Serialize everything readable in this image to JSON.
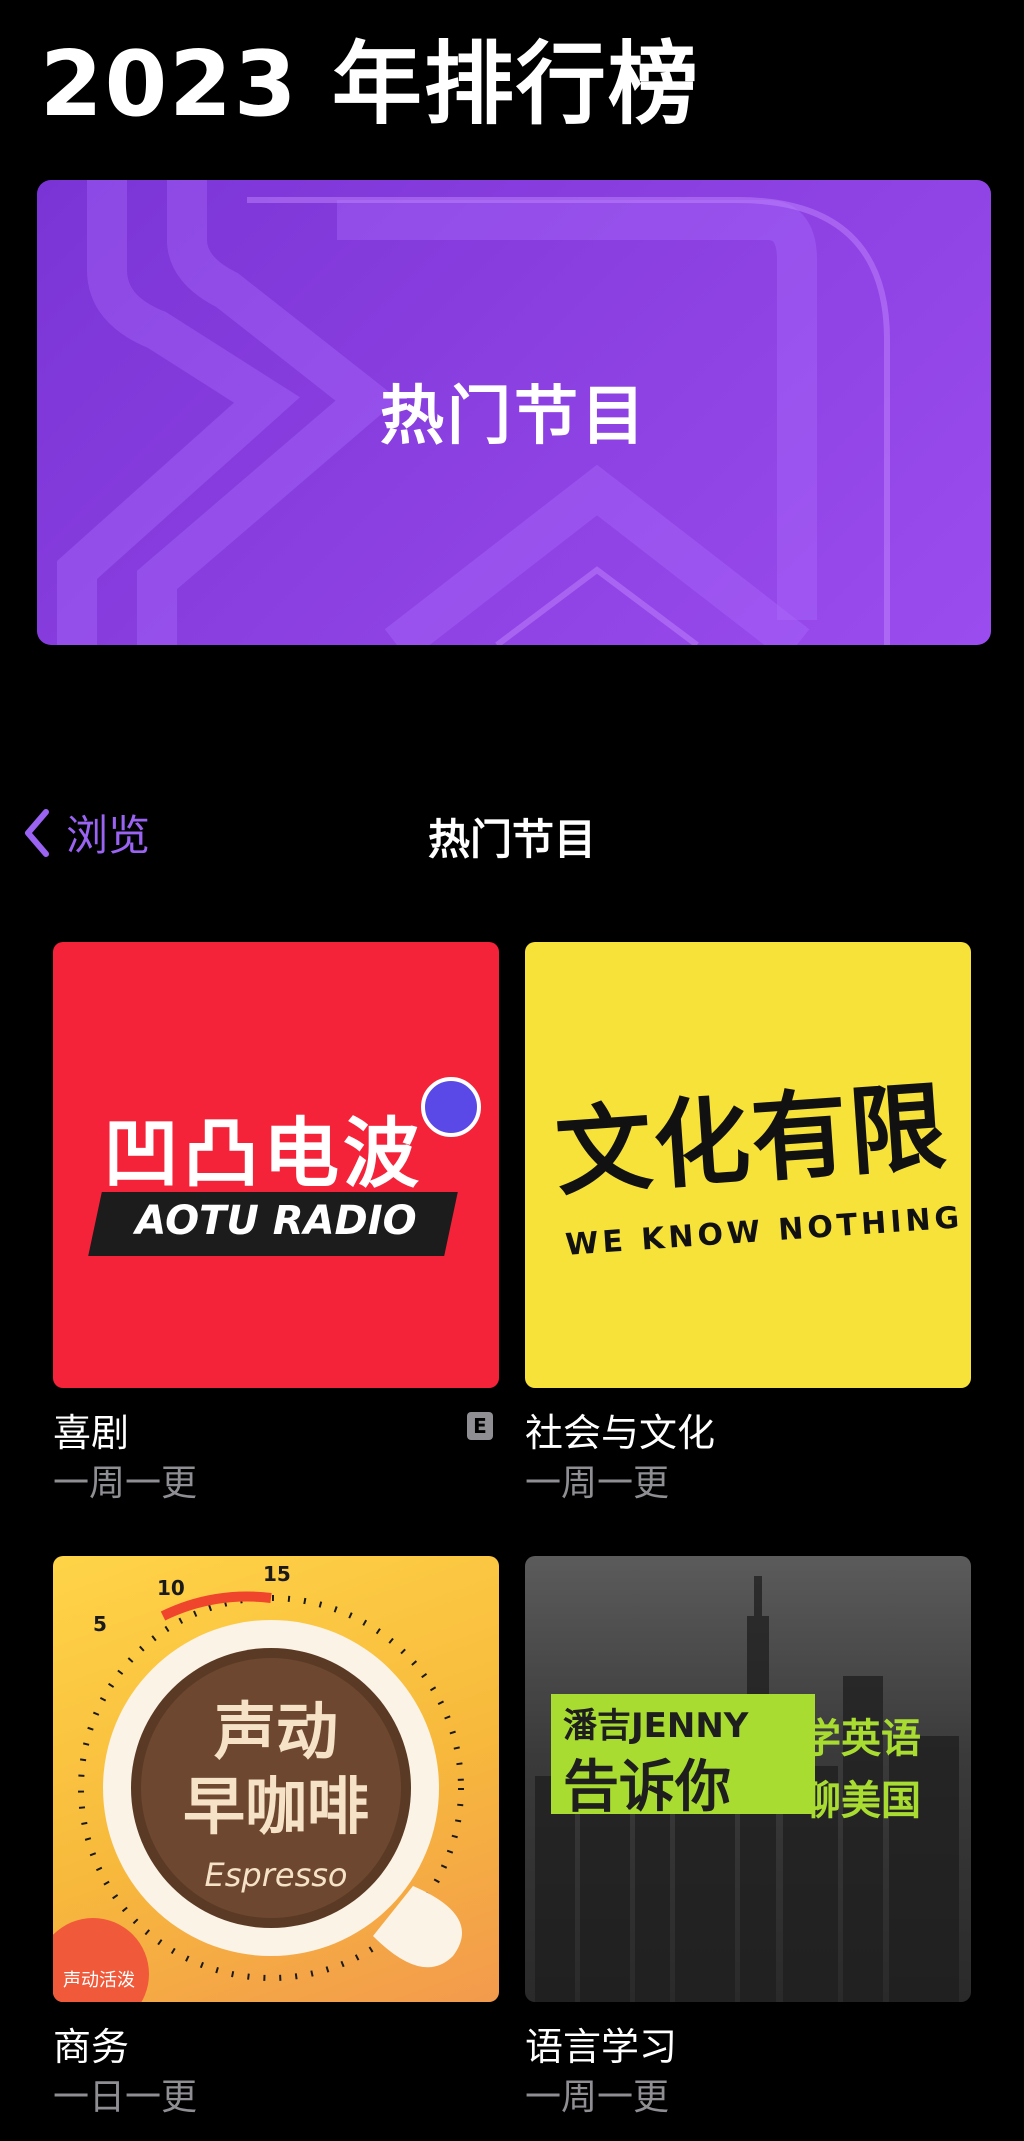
{
  "page_title": "2023 年排行榜",
  "hero": {
    "title": "热门节目"
  },
  "nav": {
    "back_label": "浏览",
    "title": "热门节目"
  },
  "shows": [
    {
      "art_text": "凹凸电波",
      "art_subtitle": "AOTU RADIO",
      "category": "喜剧",
      "frequency": "一周一更",
      "explicit_badge": "E"
    },
    {
      "art_text": "文化有限",
      "art_subtitle": "WE KNOW NOTHING",
      "category": "社会与文化",
      "frequency": "一周一更"
    },
    {
      "art_text_line1": "声动",
      "art_text_line2": "早咖啡",
      "art_subtitle": "Espresso",
      "art_badge": "声动活泼",
      "dial_labels": [
        "5",
        "10",
        "15"
      ],
      "category": "商务",
      "frequency": "一日一更"
    },
    {
      "art_text_line1": "潘吉JENNY",
      "art_text_line2": "告诉你",
      "art_side_line1": "学英语",
      "art_side_line2": "聊美国",
      "category": "语言学习",
      "frequency": "一周一更"
    }
  ],
  "colors": {
    "accent": "#9a63f2",
    "hero_purple": "#8a3fe0",
    "secondary_text": "#8e8e93"
  }
}
